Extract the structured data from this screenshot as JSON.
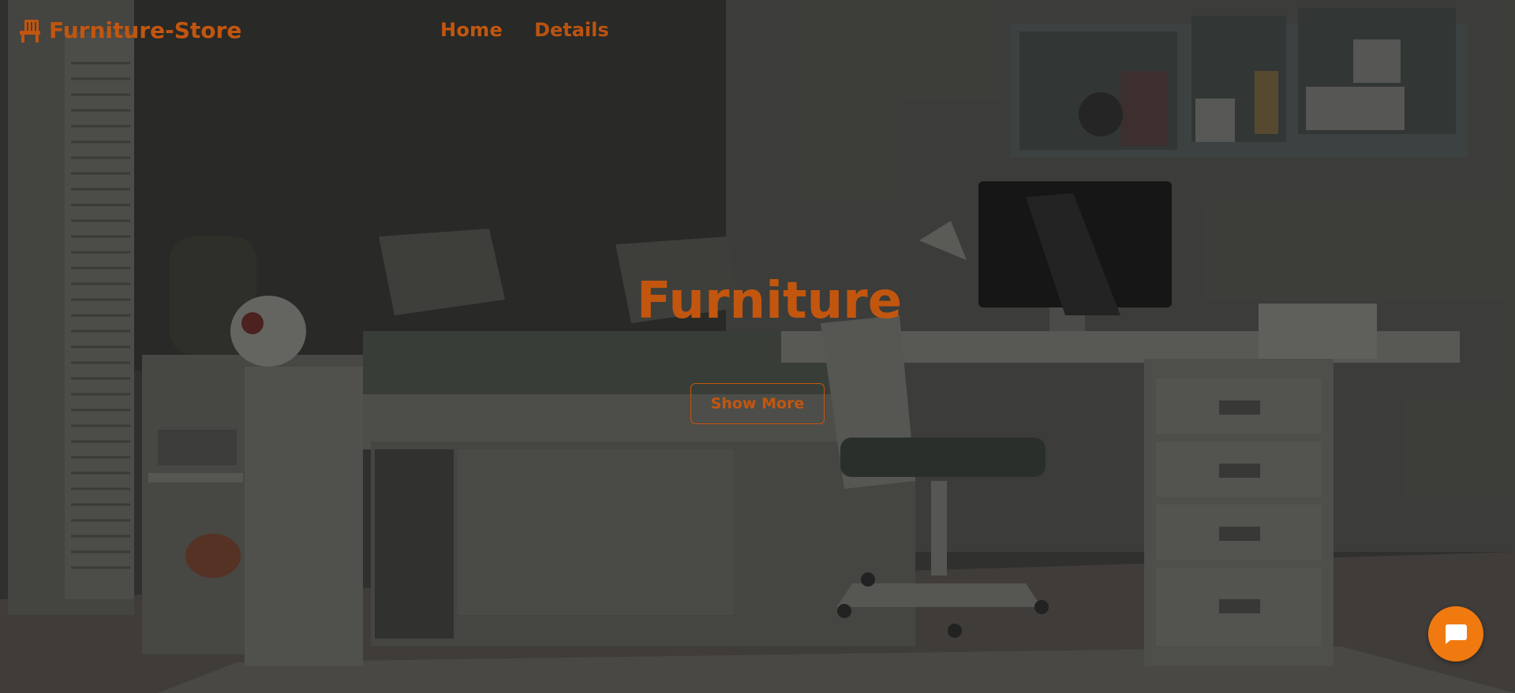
{
  "brand": {
    "name": "Furniture-Store",
    "icon": "chair-icon"
  },
  "nav": {
    "items": [
      {
        "label": "Home"
      },
      {
        "label": "Details"
      }
    ]
  },
  "hero": {
    "title": "Furniture",
    "button_label": "Show More"
  },
  "chat": {
    "icon": "chat-bubble-icon"
  },
  "colors": {
    "accent": "#c2560f",
    "chat_button": "#f07a10"
  }
}
